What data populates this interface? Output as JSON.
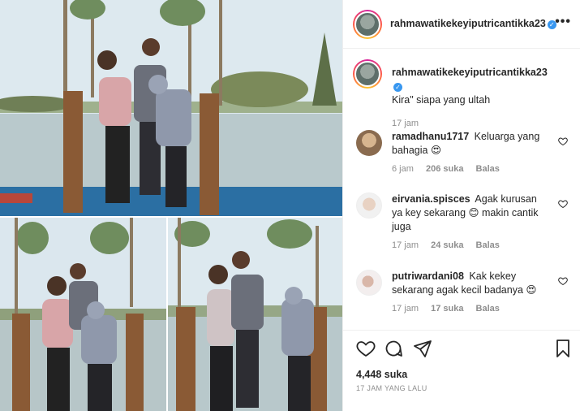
{
  "post": {
    "author": "rahmawatikekeyiputricantikka23",
    "caption_author": "rahmawatikekeyiputricantikka23",
    "caption": "Kira\" siapa yang ultah",
    "caption_time": "17 jam",
    "likes": "4,448 suka",
    "posted_ago": "17 JAM YANG LALU",
    "verified_glyph": "✓",
    "more_glyph": "•••"
  },
  "comments": [
    {
      "username": "ramadhanu1717",
      "text": "Keluarga yang bahagia 😍",
      "time": "6 jam",
      "likes": "206 suka",
      "reply": "Balas"
    },
    {
      "username": "eirvania.spisces",
      "text": "Agak kurusan ya key sekarang 😊 makin cantik juga",
      "time": "17 jam",
      "likes": "24 suka",
      "reply": "Balas"
    },
    {
      "username": "putriwardani08",
      "text": "Kak kekey sekarang agak kecil badanya 😍",
      "time": "17 jam",
      "likes": "17 suka",
      "reply": "Balas"
    }
  ],
  "icons": {
    "like": "heart-icon",
    "comment": "comment-icon",
    "share": "share-icon",
    "save": "bookmark-icon",
    "more": "more-options-icon"
  },
  "colors": {
    "verified": "#3897f0",
    "secondary_text": "#8e8e8e",
    "border": "#efefef"
  }
}
